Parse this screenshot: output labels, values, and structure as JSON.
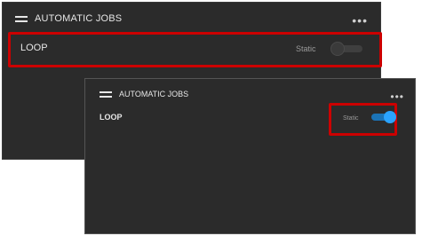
{
  "back_panel": {
    "header_title": "AUTOMATIC JOBS",
    "more_menu": "•••",
    "row": {
      "label": "LOOP",
      "toggle_label": "Static",
      "toggle_on": false
    }
  },
  "front_panel": {
    "header_title": "AUTOMATIC JOBS",
    "more_menu": "•••",
    "row": {
      "label": "LOOP",
      "toggle_label": "Static",
      "toggle_on": true
    }
  },
  "colors": {
    "panel_bg": "#2b2b2b",
    "highlight_red": "#cc0000",
    "toggle_on_knob": "#2aa3ff",
    "toggle_on_track": "#1b73b6",
    "toggle_off_knob": "#3a3a3a"
  },
  "icons": {
    "menu": "hamburger-icon",
    "more": "more-horizontal-icon"
  }
}
